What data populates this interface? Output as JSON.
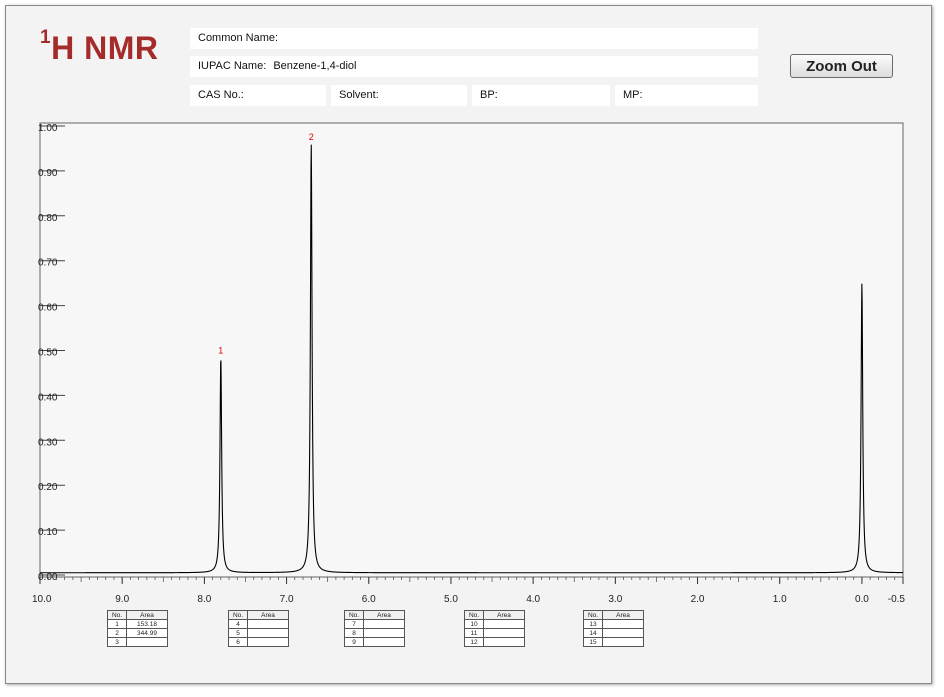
{
  "header": {
    "title_sup": "1",
    "title_main": "H NMR",
    "common_name_label": "Common Name:",
    "common_name_value": "",
    "iupac_label": "IUPAC Name:",
    "iupac_value": "Benzene-1,4-diol",
    "cas_label": "CAS No.:",
    "solvent_label": "Solvent:",
    "bp_label": "BP:",
    "mp_label": "MP:"
  },
  "toolbar": {
    "zoom_out_label": "Zoom Out"
  },
  "chart_data": {
    "type": "line",
    "title": "",
    "xlabel": "",
    "ylabel": "",
    "xlim": [
      10.0,
      -0.5
    ],
    "ylim": [
      0.0,
      1.0
    ],
    "x_reversed": true,
    "x_ticks": [
      {
        "v": 10.0,
        "label": "10.0"
      },
      {
        "v": 9.0,
        "label": "9.0"
      },
      {
        "v": 8.0,
        "label": "8.0"
      },
      {
        "v": 7.0,
        "label": "7.0"
      },
      {
        "v": 6.0,
        "label": "6.0"
      },
      {
        "v": 5.0,
        "label": "5.0"
      },
      {
        "v": 4.0,
        "label": "4.0"
      },
      {
        "v": 3.0,
        "label": "3.0"
      },
      {
        "v": 2.0,
        "label": "2.0"
      },
      {
        "v": 1.0,
        "label": "1.0"
      },
      {
        "v": 0.0,
        "label": "0.0"
      },
      {
        "v": -0.5,
        "label": "-0.5"
      }
    ],
    "y_ticks": [
      {
        "v": 1.0,
        "label": "1.00"
      },
      {
        "v": 0.9,
        "label": "0.90"
      },
      {
        "v": 0.8,
        "label": "0.80"
      },
      {
        "v": 0.7,
        "label": "0.70"
      },
      {
        "v": 0.6,
        "label": "0.60"
      },
      {
        "v": 0.5,
        "label": "0.50"
      },
      {
        "v": 0.4,
        "label": "0.40"
      },
      {
        "v": 0.3,
        "label": "0.30"
      },
      {
        "v": 0.2,
        "label": "0.20"
      },
      {
        "v": 0.1,
        "label": "0.10"
      },
      {
        "v": 0.0,
        "label": "0.00"
      }
    ],
    "baseline": 0.005,
    "peaks": [
      {
        "label": "1",
        "shift": 7.8,
        "height": 0.48
      },
      {
        "label": "2",
        "shift": 6.7,
        "height": 0.955
      },
      {
        "label": "",
        "shift": 0.0,
        "height": 0.645
      }
    ],
    "integration_tables": [
      {
        "header": [
          "No.",
          "Area"
        ],
        "rows": [
          [
            "1",
            "153.18"
          ],
          [
            "2",
            "344.99"
          ],
          [
            "3",
            ""
          ]
        ]
      },
      {
        "header": [
          "No.",
          "Area"
        ],
        "rows": [
          [
            "4",
            ""
          ],
          [
            "5",
            ""
          ],
          [
            "6",
            ""
          ]
        ]
      },
      {
        "header": [
          "No.",
          "Area"
        ],
        "rows": [
          [
            "7",
            ""
          ],
          [
            "8",
            ""
          ],
          [
            "9",
            ""
          ]
        ]
      },
      {
        "header": [
          "No.",
          "Area"
        ],
        "rows": [
          [
            "10",
            ""
          ],
          [
            "11",
            ""
          ],
          [
            "12",
            ""
          ]
        ]
      },
      {
        "header": [
          "No.",
          "Area"
        ],
        "rows": [
          [
            "13",
            ""
          ],
          [
            "14",
            ""
          ],
          [
            "15",
            ""
          ]
        ]
      }
    ],
    "colors": {
      "trace": "#000000",
      "peak_label": "#e00000",
      "axis": "#333333"
    }
  }
}
